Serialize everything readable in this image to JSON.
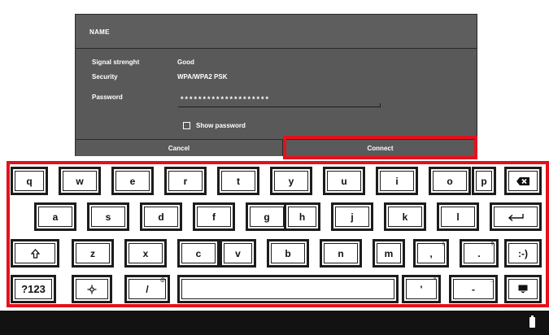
{
  "dialog": {
    "title": "NAME",
    "signal_label": "Signal strenght",
    "signal_value": "Good",
    "security_label": "Security",
    "security_value": "WPA/WPA2 PSK",
    "password_label": "Password",
    "password_value": "********************",
    "show_password_label": "Show password",
    "cancel_label": "Cancel",
    "connect_label": "Connect"
  },
  "keyboard": {
    "row1": [
      "q",
      "w",
      "e",
      "r",
      "t",
      "y",
      "u",
      "i",
      "o",
      "p"
    ],
    "row2": [
      "a",
      "s",
      "d",
      "f",
      "g",
      "h",
      "j",
      "k",
      "l"
    ],
    "row3": [
      "z",
      "x",
      "c",
      "v",
      "b",
      "n",
      "m",
      ",",
      "."
    ],
    "row3_sub": {
      ",": "!",
      ".": "?"
    },
    "smiley": ":-)",
    "symbols": "?123",
    "slash": "/",
    "slash_sub": "@",
    "apostrophe": "'",
    "apostrophe_sub": "\"",
    "dash": "-",
    "dash_sub": "_",
    "icons": [
      "backspace-icon",
      "enter-icon",
      "shift-icon",
      "settings-icon",
      "keyboard-hide-icon"
    ]
  },
  "colors": {
    "dialog_bg": "#595959",
    "highlight": "#e3111b",
    "bottom_bar": "#121212"
  },
  "status": {
    "battery_icon": "battery-icon"
  }
}
